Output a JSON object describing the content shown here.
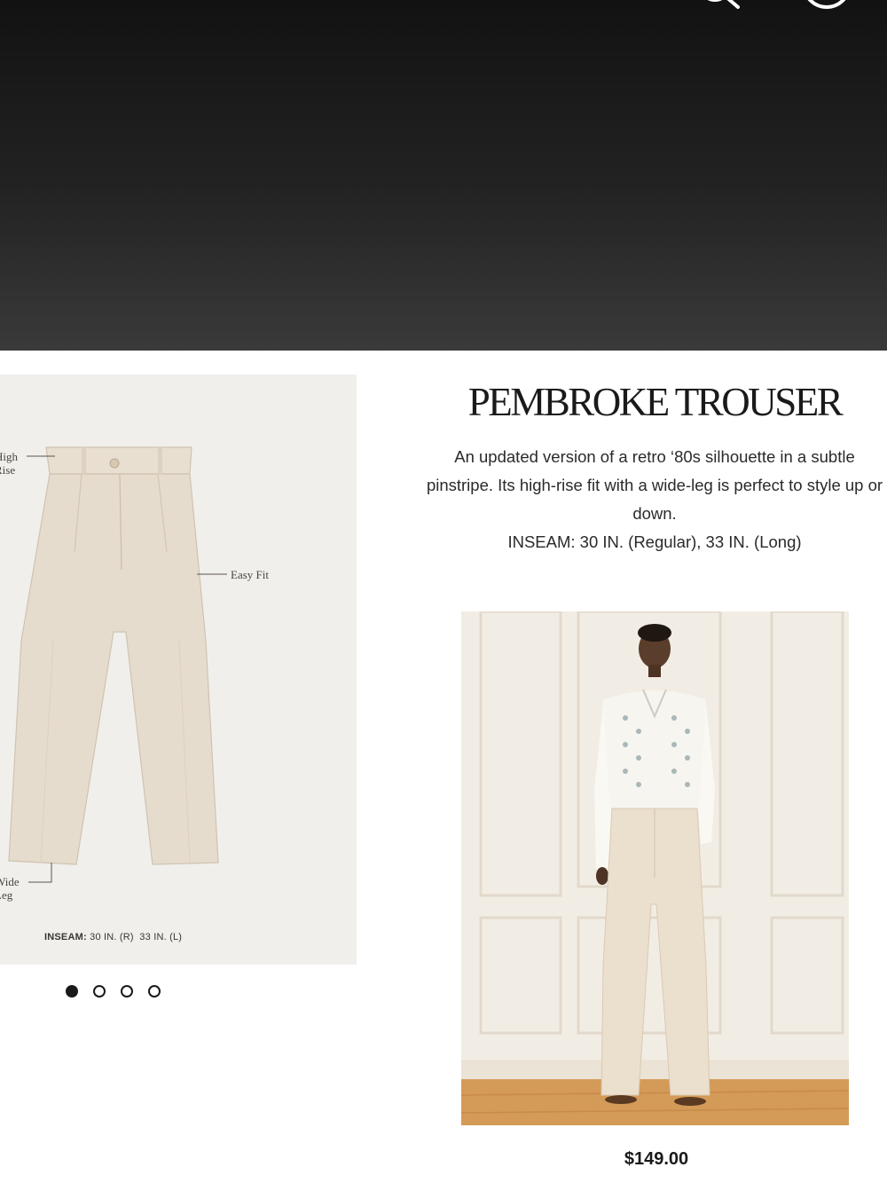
{
  "header": {
    "icons": [
      "search-icon",
      "account-icon"
    ],
    "background": "#1c1c1c"
  },
  "diagram": {
    "callouts": {
      "high_rise": "High\nRise",
      "easy_fit": "Easy Fit",
      "wide_leg": "Wide\nLeg"
    },
    "inseam_label": "INSEAM:",
    "inseam_values": "30 IN. (R)  33 IN. (L)"
  },
  "carousel": {
    "total": 4,
    "active_index": 0
  },
  "product": {
    "title": "PEMBROKE TROUSER",
    "description": "An updated version of a retro ‘80s silhouette in a subtle pinstripe. Its high-rise fit with a wide-leg is perfect to style up or down.",
    "inseam": "INSEAM: 30 IN. (Regular), 33 IN. (Long)",
    "price": "$149.00"
  },
  "colors": {
    "trouser": "#e6dccd",
    "card_bg": "#f1efeb",
    "text": "#1a1a1a"
  }
}
